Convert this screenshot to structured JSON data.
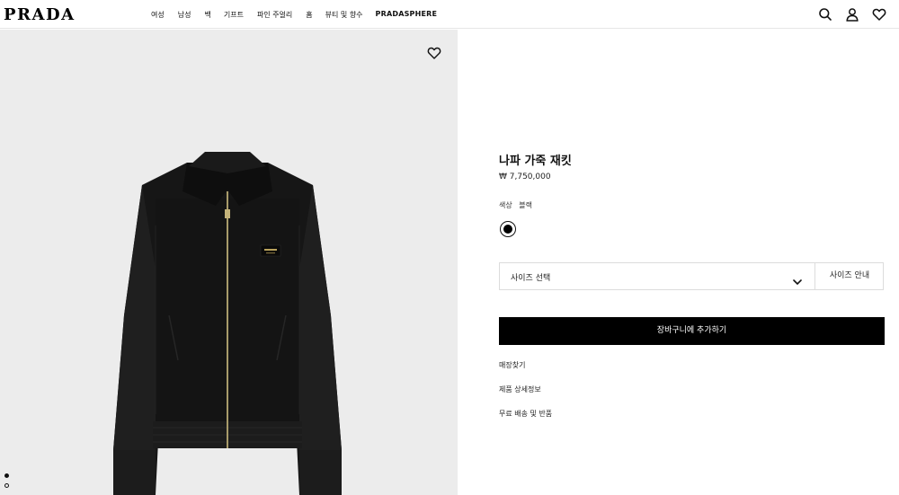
{
  "header": {
    "logo": "PRADA",
    "nav": [
      "여성",
      "남성",
      "백",
      "기프트",
      "파인 주얼리",
      "홈",
      "뷰티 및 향수",
      "PRADASPHERE"
    ],
    "icons": [
      "search-icon",
      "account-icon",
      "wishlist-icon"
    ]
  },
  "gallery": {
    "wishlist_icon": "heart-icon",
    "slide_count": 2,
    "active_slide": 1
  },
  "product": {
    "title": "나파 가죽 재킷",
    "price": "₩ 7,750,000",
    "color_label": "색상",
    "color_value": "블랙",
    "swatch_color": "#000000",
    "size_select_label": "사이즈 선택",
    "size_guide_label": "사이즈 안내",
    "add_to_cart_label": "장바구니에 추가하기",
    "links": [
      "매장찾기",
      "제품 상세정보",
      "무료 배송 및 반품"
    ]
  },
  "colors": {
    "image_background": "#ececec",
    "button_background": "#000000",
    "button_text": "#ffffff"
  }
}
